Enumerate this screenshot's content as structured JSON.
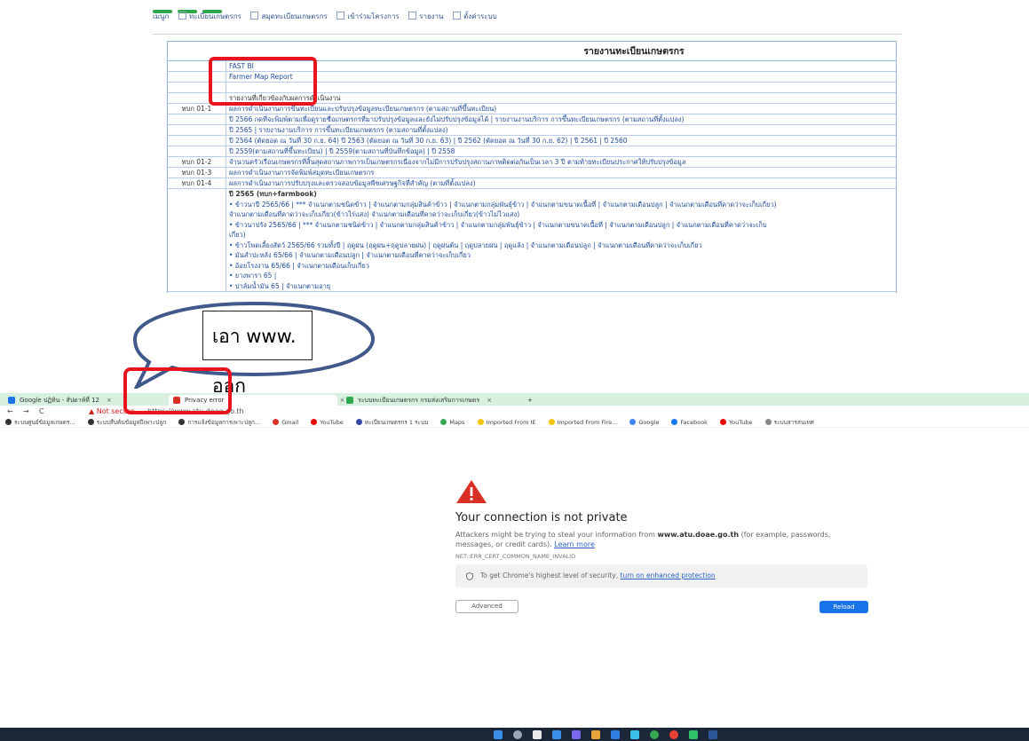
{
  "report_page": {
    "menu_items": [
      "เมนูก",
      "ทะเบียนเกษตรกร",
      "สมุดทะเบียนเกษตรกร",
      "เข้าร่วมโครงการ",
      "รายงาน",
      "ตั้งค่าระบบ"
    ],
    "title": "รายงานทะเบียนเกษตรกร",
    "rows": [
      {
        "code": "",
        "text": "FAST BI"
      },
      {
        "code": "",
        "text": "Farmer Map Report"
      },
      {
        "code": "",
        "text": ""
      },
      {
        "code": "",
        "text": "รายงานที่เกี่ยวข้องกับผลการดำเนินงาน"
      },
      {
        "code": "ทบก 01-1",
        "text": "ผลการดำเนินงานการขึ้นทะเบียนและปรับปรุงข้อมูลทะเบียนเกษตรกร (ตามสถานที่ขึ้นทะเบียน)"
      },
      {
        "code": "",
        "text": "ปี 2566 กดที่จะพิมพ์ตามเพื่อดูรายชื่อเกษตรกรที่มาปรับปรุงข้อมูลและยังไม่ปรับปรุงข้อมูลได้ | รายงานงานบริการ การขึ้นทะเบียนเกษตรกร (ตามสถานที่ตั้งแปลง)"
      },
      {
        "code": "",
        "text": "ปี 2565 | รายงานงานบริการ การขึ้นทะเบียนเกษตรกร (ตามสถานที่ตั้งแปลง)"
      },
      {
        "code": "",
        "text": "ปี 2564 (ตัดยอด ณ วันที่ 30 ก.ย. 64) ปี 2563 (ตัดยอด ณ วันที่ 30 ก.ย. 63) | ปี 2562 (ตัดยอด ณ วันที่ 30 ก.ย. 62) | ปี 2561 | ปี 2560"
      },
      {
        "code": "",
        "text": "ปี 2559(ตามสถานที่ขึ้นทะเบียน) | ปี 2559(ตามสถานที่บันทึกข้อมูล) | ปี 2558"
      },
      {
        "code": "ทบก 01-2",
        "text": "จำนวนครัวเรือนเกษตรกรที่สิ้นสุดสถานภาพการเป็นเกษตรกรเนื่องจากไม่มีการปรับปรุงสถานภาพติดต่อกันเป็นเวลา 3 ปี ตามท้ายทะเบียนประกาศให้ปรับปรุงข้อมูล"
      },
      {
        "code": "ทบก 01-3",
        "text": "ผลการดำเนินงานการจัดพิมพ์สมุดทะเบียนเกษตรกร"
      },
      {
        "code": "ทบก 01-4",
        "text": "ผลการดำเนินงานการปรับปรุงและตรวจสอบข้อมูลพืชเศรษฐกิจที่สำคัญ (ตามที่ตั้งแปลง)"
      }
    ],
    "block_2565_title": "ปี 2565 (ทบก+farmbook)",
    "block_2565_lines": [
      "• ข้าวนาปี 2565/66 | *** จำแนกตามชนิดข้าว | จำแนกตามกลุ่มสินค้าข้าว | จำแนกตามกลุ่มพันธุ์ข้าว | จำแนกตามขนาดเนื้อที่ | จำแนกตามเดือนปลูก | จำแนกตามเดือนที่คาดว่าจะเก็บเกี่ยว)",
      "จำแนกตามเดือนที่คาดว่าจะเก็บเกี่ยว(ข้าวไร่แสง) จำแนกตามเดือนที่คาดว่าจะเก็บเกี่ยว(ข้าวไม่ไวแสง)",
      "• ข้าวนาปรัง 2565/66 | *** จำแนกตามชนิดข้าว | จำแนกตามกลุ่มสินค้าข้าว | จำแนกตามกลุ่มพันธุ์ข้าว | จำแนกตามขนาดเนื้อที่ | จำแนกตามเดือนปลูก | จำแนกตามเดือนที่คาดว่าจะเก็บ",
      "เกี่ยว)",
      "• ข้าวโพดเลี้ยงสัตว์ 2565/66 รวมทั้งปี | ฤดูฝน (ฤดูฝน+ฤดูปลายฝน) | ฤดูฝนต้น | ฤดูปลายฝน | ฤดูแล้ง | จำแนกตามเดือนปลูก | จำแนกตามเดือนที่คาดว่าจะเก็บเกี่ยว",
      "• มันสำปะหลัง 65/66 | จำแนกตามเดือนปลูก | จำแนกตามเดือนที่คาดว่าจะเก็บเกี่ยว",
      "• อ้อยโรงงาน 65/66 | จำแนกตามเดือนเก็บเกี่ยว",
      "• ยางพารา 65 |",
      "• ปาล์มน้ำมัน 65 | จำแนกตามอายุ"
    ]
  },
  "callout": {
    "text": "เอา www. ออก"
  },
  "browser": {
    "tabs": [
      {
        "label": "Google ปฏิทิน - สัปดาห์ที่ 12",
        "fav_color": "#1a73e8"
      },
      {
        "label": "Privacy error",
        "fav_color": "#d93025"
      },
      {
        "label": "ระบบทะเบียนเกษตรกร กรมส่งเสริมการเกษตร",
        "fav_color": "#2ea84a"
      }
    ],
    "new_tab_label": "+",
    "back_label": "←",
    "forward_label": "→",
    "reload_label": "C",
    "not_secure": "▲ Not secure",
    "url": "https://www.atu.doae.go.th",
    "bookmarks": [
      "ระบบศูนย์ข้อมูลเกษตร...",
      "ระบบสืบค้นข้อมูลปีเพาะปลูก",
      "การแจ้งข้อมูลการเพาะปลูก...",
      "Gmail",
      "YouTube",
      "ทะเบียนเกษตรกร 1 ระบบ",
      "Maps",
      "Imported From IE",
      "Imported From Fire...",
      "Google",
      "Facebook",
      "YouTube",
      "ระบบสารสนเทศ"
    ],
    "error_title": "Your connection is not private",
    "error_desc_1": "Attackers might be trying to steal your information from",
    "error_domain": "www.atu.doae.go.th",
    "error_desc_2": "(for example, passwords, messages, or credit cards).",
    "learn_more": "Learn more",
    "error_code": "NET::ERR_CERT_COMMON_NAME_INVALID",
    "enhanced_text": "To get Chrome's highest level of security,",
    "enhanced_link": "turn on enhanced protection",
    "advanced_label": "Advanced",
    "reload_button_label": "Reload"
  }
}
